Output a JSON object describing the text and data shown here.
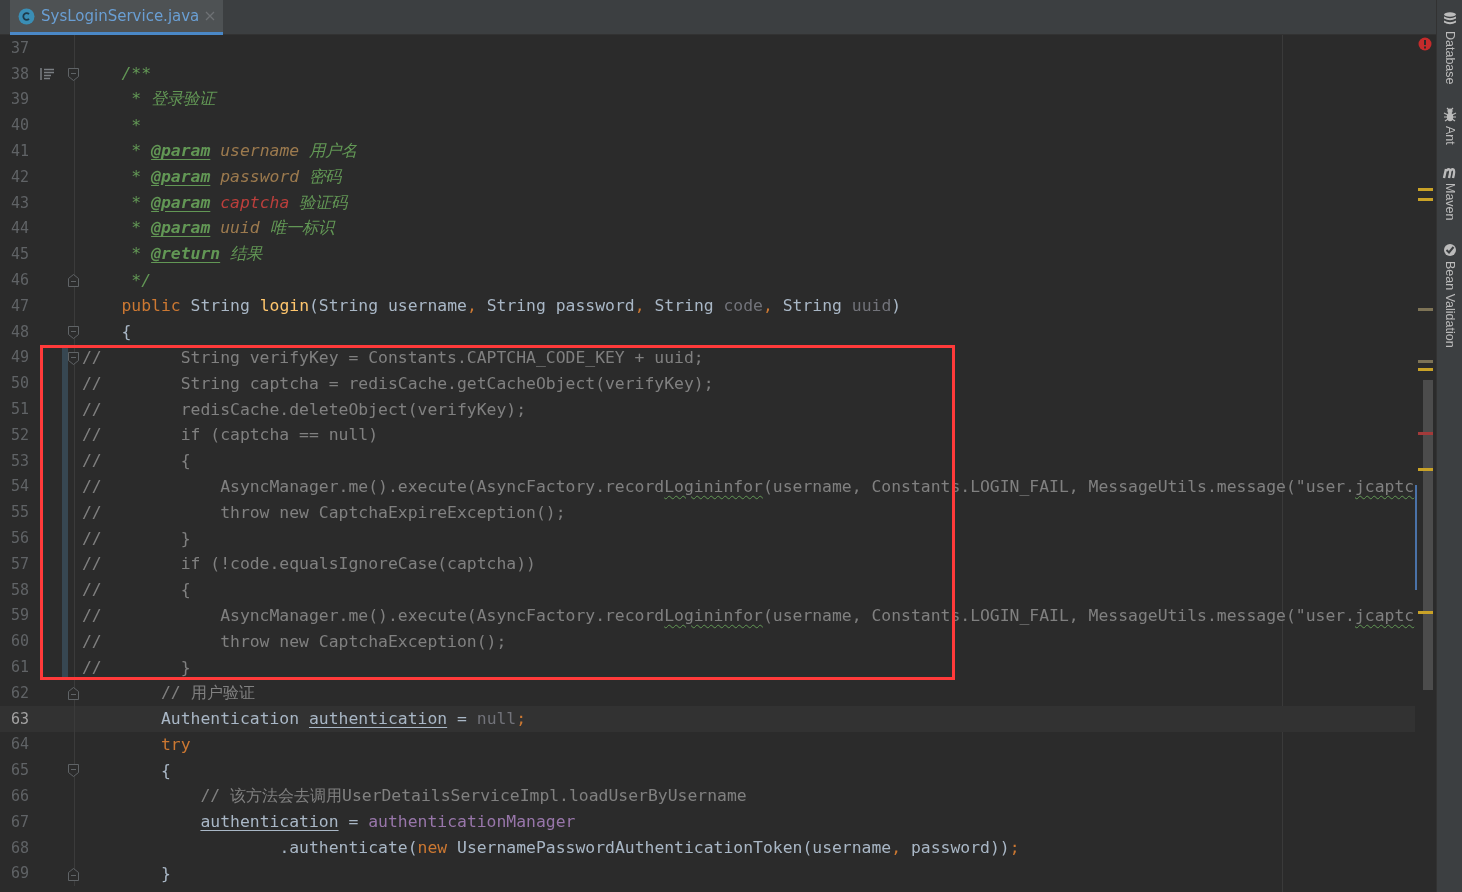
{
  "tab": {
    "title": "SysLoginService.java",
    "selected": true
  },
  "editor": {
    "lines": [
      {
        "number": "37",
        "current": false,
        "changed": false
      },
      {
        "number": "38",
        "current": false,
        "changed": false,
        "gutter_icon": {
          "kind": "doc"
        },
        "fold_marker": {
          "kind": "start"
        },
        "tokens": [
          {
            "text": "    /**",
            "kind": "doc"
          }
        ]
      },
      {
        "number": "39",
        "current": false,
        "changed": false,
        "tokens": [
          {
            "text": "     * 登录验证",
            "kind": "doc"
          }
        ]
      },
      {
        "number": "40",
        "current": false,
        "changed": false,
        "tokens": [
          {
            "text": "     *",
            "kind": "doc"
          }
        ]
      },
      {
        "number": "41",
        "current": false,
        "changed": false,
        "tokens": [
          {
            "text": "     * ",
            "kind": "doc"
          },
          {
            "text": "@param",
            "kind": "doc-tag"
          },
          {
            "text": " username",
            "kind": "doc-param"
          },
          {
            "text": " 用户名",
            "kind": "doc"
          }
        ]
      },
      {
        "number": "42",
        "current": false,
        "changed": false,
        "tokens": [
          {
            "text": "     * ",
            "kind": "doc"
          },
          {
            "text": "@param",
            "kind": "doc-tag"
          },
          {
            "text": " password",
            "kind": "doc-param"
          },
          {
            "text": " 密码",
            "kind": "doc"
          }
        ]
      },
      {
        "number": "43",
        "current": false,
        "changed": false,
        "tokens": [
          {
            "text": "     * ",
            "kind": "doc"
          },
          {
            "text": "@param",
            "kind": "doc-tag"
          },
          {
            "text": " captcha",
            "kind": "doc-param-error"
          },
          {
            "text": " 验证码",
            "kind": "doc"
          }
        ]
      },
      {
        "number": "44",
        "current": false,
        "changed": false,
        "tokens": [
          {
            "text": "     * ",
            "kind": "doc"
          },
          {
            "text": "@param",
            "kind": "doc-tag"
          },
          {
            "text": " uuid",
            "kind": "doc-param"
          },
          {
            "text": " 唯一标识",
            "kind": "doc"
          }
        ]
      },
      {
        "number": "45",
        "current": false,
        "changed": false,
        "tokens": [
          {
            "text": "     * ",
            "kind": "doc"
          },
          {
            "text": "@return",
            "kind": "doc-tag"
          },
          {
            "text": " 结果",
            "kind": "doc"
          }
        ]
      },
      {
        "number": "46",
        "current": false,
        "changed": false,
        "fold_marker": {
          "kind": "end"
        },
        "tokens": [
          {
            "text": "     */",
            "kind": "doc"
          }
        ]
      },
      {
        "number": "47",
        "current": false,
        "changed": false,
        "tokens": [
          {
            "text": "    public",
            "kind": "keyword"
          },
          {
            "text": " String ",
            "kind": "plain"
          },
          {
            "text": "login",
            "kind": "method"
          },
          {
            "text": "(String username",
            "kind": "plain"
          },
          {
            "text": ",",
            "kind": "punct"
          },
          {
            "text": " String password",
            "kind": "plain"
          },
          {
            "text": ",",
            "kind": "punct"
          },
          {
            "text": " String ",
            "kind": "plain"
          },
          {
            "text": "code",
            "kind": "unused"
          },
          {
            "text": ",",
            "kind": "punct"
          },
          {
            "text": " String ",
            "kind": "plain"
          },
          {
            "text": "uuid",
            "kind": "unused"
          },
          {
            "text": ")",
            "kind": "plain"
          }
        ]
      },
      {
        "number": "48",
        "current": false,
        "changed": false,
        "fold_marker": {
          "kind": "start"
        },
        "tokens": [
          {
            "text": "    {",
            "kind": "plain"
          }
        ]
      },
      {
        "number": "49",
        "current": false,
        "changed": true,
        "fold_marker": {
          "kind": "start"
        },
        "tokens": [
          {
            "text": "//        String verifyKey = Constants.CAPTCHA_CODE_KEY + uuid;",
            "kind": "comment"
          }
        ]
      },
      {
        "number": "50",
        "current": false,
        "changed": true,
        "tokens": [
          {
            "text": "//        String captcha = redisCache.getCacheObject(verifyKey);",
            "kind": "comment"
          }
        ]
      },
      {
        "number": "51",
        "current": false,
        "changed": true,
        "tokens": [
          {
            "text": "//        redisCache.deleteObject(verifyKey);",
            "kind": "comment"
          }
        ]
      },
      {
        "number": "52",
        "current": false,
        "changed": true,
        "tokens": [
          {
            "text": "//        if (captcha == null)",
            "kind": "comment"
          }
        ]
      },
      {
        "number": "53",
        "current": false,
        "changed": true,
        "tokens": [
          {
            "text": "//        {",
            "kind": "comment"
          }
        ]
      },
      {
        "number": "54",
        "current": false,
        "changed": true,
        "tokens": [
          {
            "text": "//            AsyncManager.me().execute(AsyncFactory.record",
            "kind": "comment"
          },
          {
            "text": "Logininfor",
            "kind": "typo"
          },
          {
            "text": "(username, Constants.LOGIN_FAIL, MessageUtils.message(\"user.",
            "kind": "comment"
          },
          {
            "text": "jcaptc",
            "kind": "typo"
          }
        ]
      },
      {
        "number": "55",
        "current": false,
        "changed": true,
        "tokens": [
          {
            "text": "//            throw new CaptchaExpireException();",
            "kind": "comment"
          }
        ]
      },
      {
        "number": "56",
        "current": false,
        "changed": true,
        "tokens": [
          {
            "text": "//        }",
            "kind": "comment"
          }
        ]
      },
      {
        "number": "57",
        "current": false,
        "changed": true,
        "tokens": [
          {
            "text": "//        if (!code.equalsIgnoreCase(captcha))",
            "kind": "comment"
          }
        ]
      },
      {
        "number": "58",
        "current": false,
        "changed": true,
        "tokens": [
          {
            "text": "//        {",
            "kind": "comment"
          }
        ]
      },
      {
        "number": "59",
        "current": false,
        "changed": true,
        "tokens": [
          {
            "text": "//            AsyncManager.me().execute(AsyncFactory.record",
            "kind": "comment"
          },
          {
            "text": "Logininfor",
            "kind": "typo"
          },
          {
            "text": "(username, Constants.LOGIN_FAIL, MessageUtils.message(\"user.",
            "kind": "comment"
          },
          {
            "text": "jcaptc",
            "kind": "typo"
          }
        ]
      },
      {
        "number": "60",
        "current": false,
        "changed": true,
        "tokens": [
          {
            "text": "//            throw new CaptchaException();",
            "kind": "comment"
          }
        ]
      },
      {
        "number": "61",
        "current": false,
        "changed": true,
        "tokens": [
          {
            "text": "//        }",
            "kind": "comment"
          }
        ]
      },
      {
        "number": "62",
        "current": false,
        "changed": false,
        "fold_marker": {
          "kind": "end"
        },
        "tokens": [
          {
            "text": "        // 用户验证",
            "kind": "comment"
          }
        ]
      },
      {
        "number": "63",
        "current": true,
        "changed": false,
        "tokens": [
          {
            "text": "        Authentication ",
            "kind": "plain"
          },
          {
            "text": "authentication",
            "kind": "reassigned"
          },
          {
            "text": " = ",
            "kind": "plain"
          },
          {
            "text": "null",
            "kind": "unused"
          },
          {
            "text": ";",
            "kind": "punct"
          }
        ]
      },
      {
        "number": "64",
        "current": false,
        "changed": false,
        "tokens": [
          {
            "text": "        try",
            "kind": "keyword"
          }
        ]
      },
      {
        "number": "65",
        "current": false,
        "changed": false,
        "fold_marker": {
          "kind": "start"
        },
        "tokens": [
          {
            "text": "        {",
            "kind": "plain"
          }
        ]
      },
      {
        "number": "66",
        "current": false,
        "changed": false,
        "tokens": [
          {
            "text": "            // 该方法会去调用UserDetailsServiceImpl.loadUserByUsername",
            "kind": "comment"
          }
        ]
      },
      {
        "number": "67",
        "current": false,
        "changed": false,
        "tokens": [
          {
            "text": "            authentication",
            "kind": "reassigned"
          },
          {
            "text": " = ",
            "kind": "plain"
          },
          {
            "text": "authenticationManager",
            "kind": "field"
          }
        ]
      },
      {
        "number": "68",
        "current": false,
        "changed": false,
        "tokens": [
          {
            "text": "                    .authenticate(",
            "kind": "plain"
          },
          {
            "text": "new",
            "kind": "keyword"
          },
          {
            "text": " UsernamePasswordAuthenticationToken(username",
            "kind": "plain"
          },
          {
            "text": ",",
            "kind": "punct"
          },
          {
            "text": " password))",
            "kind": "plain"
          },
          {
            "text": ";",
            "kind": "punct"
          }
        ]
      },
      {
        "number": "69",
        "current": false,
        "changed": false,
        "fold_marker": {
          "kind": "end"
        },
        "tokens": [
          {
            "text": "        }",
            "kind": "plain"
          }
        ]
      }
    ]
  },
  "tool_windows": [
    {
      "label": "Database",
      "kind": "database"
    },
    {
      "label": "Ant",
      "kind": "ant"
    },
    {
      "label": "Maven",
      "kind": "maven"
    },
    {
      "label": "Bean Validation",
      "kind": "validation"
    }
  ]
}
